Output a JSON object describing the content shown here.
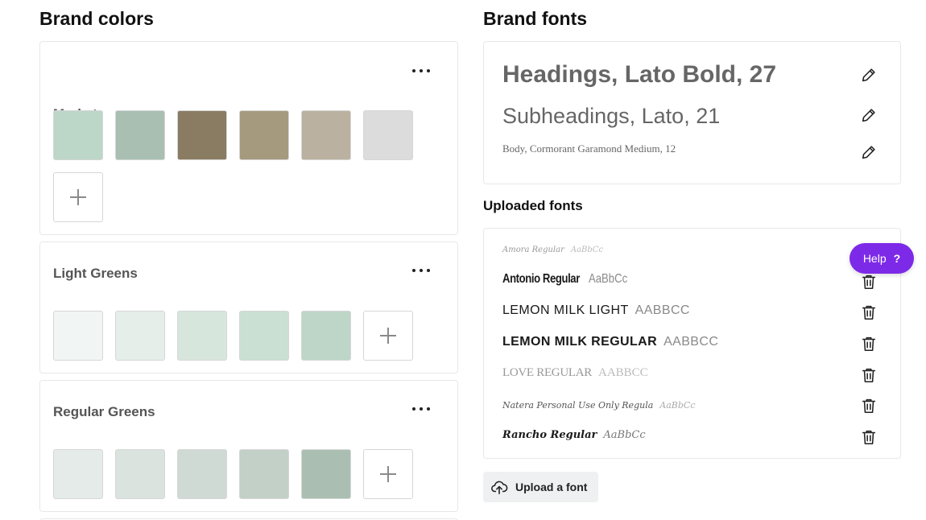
{
  "brand_colors": {
    "title": "Brand colors",
    "palettes": [
      {
        "name": "Market",
        "colors": [
          "#bcd7c8",
          "#a9bfb2",
          "#8a7c62",
          "#a59a7e",
          "#bab1a0",
          "#dcdcdc"
        ]
      },
      {
        "name": "Light Greens",
        "colors": [
          "#f1f5f3",
          "#e5eee9",
          "#d7e6dd",
          "#c9e0d2",
          "#bdd6c7"
        ]
      },
      {
        "name": "Regular Greens",
        "colors": [
          "#e5ebe8",
          "#dbe3de",
          "#cfdad4",
          "#c3d0c7",
          "#aabfb1"
        ]
      }
    ]
  },
  "brand_fonts": {
    "title": "Brand fonts",
    "heading": "Headings, Lato Bold, 27",
    "subheading": "Subheadings, Lato, 21",
    "body": "Body, Cormorant Garamond Medium, 12"
  },
  "uploaded_fonts": {
    "title": "Uploaded fonts",
    "items": [
      {
        "name": "Amora Regular",
        "sample": "AaBbCc"
      },
      {
        "name": "Antonio Regular",
        "sample": "AaBbCc"
      },
      {
        "name": "LEMON MILK LIGHT",
        "sample": "AABBCC"
      },
      {
        "name": "LEMON MILK REGULAR",
        "sample": "AABBCC"
      },
      {
        "name": "LOVE REGULAR",
        "sample": "AABBCC"
      },
      {
        "name": "Natera Personal Use Only Regula",
        "sample": "AaBbCc"
      },
      {
        "name": "Rancho Regular",
        "sample": "AaBbCc"
      }
    ]
  },
  "upload_button": {
    "label": "Upload a font",
    "icon": "cloud-upload-icon"
  },
  "help": {
    "label": "Help",
    "q": "?",
    "color": "#7d2ae8"
  }
}
